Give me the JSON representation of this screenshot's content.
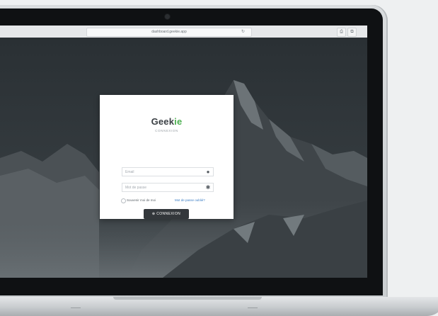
{
  "browser": {
    "url": "dashboard.geekie.app",
    "reload_icon": "↻",
    "share_icon": "⎙",
    "tabs_icon": "⧉"
  },
  "login": {
    "logo_prefix": "Geek",
    "logo_accent": "ie",
    "subtitle": "CONNEXION",
    "email_placeholder": "Email",
    "password_placeholder": "Mot de passe",
    "remember_label": "Souvenir moi de moi",
    "forgot_label": "Mot de passe oublié?",
    "submit_label": "⊕ CONNEXION"
  },
  "colors": {
    "accent": "#4caf50",
    "link": "#3b7dc4",
    "button": "#33373b"
  },
  "icons": {
    "email": "user-icon",
    "password": "asterisk-icon"
  }
}
